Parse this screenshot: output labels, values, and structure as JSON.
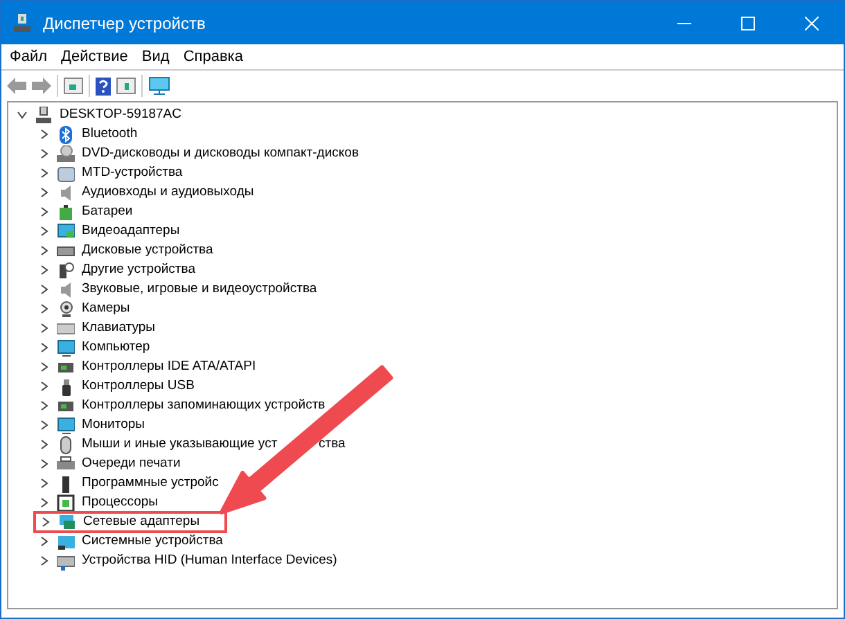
{
  "window": {
    "title": "Диспетчер устройств"
  },
  "menu": [
    "Файл",
    "Действие",
    "Вид",
    "Справка"
  ],
  "tree": {
    "label": "DESKTOP-59187AC",
    "expanded": true,
    "children": [
      {
        "label": "Bluetooth",
        "expanded": false,
        "highlighted": false
      },
      {
        "label": "DVD-дисководы и дисководы компакт-дисков",
        "expanded": false,
        "highlighted": false
      },
      {
        "label": "MTD-устройства",
        "expanded": false,
        "highlighted": false
      },
      {
        "label": "Аудиовходы и аудиовыходы",
        "expanded": false,
        "highlighted": false
      },
      {
        "label": "Батареи",
        "expanded": false,
        "highlighted": false
      },
      {
        "label": "Видеоадаптеры",
        "expanded": false,
        "highlighted": false
      },
      {
        "label": "Дисковые устройства",
        "expanded": false,
        "highlighted": false
      },
      {
        "label": "Другие устройства",
        "expanded": false,
        "highlighted": false
      },
      {
        "label": "Звуковые, игровые и видеоустройства",
        "expanded": false,
        "highlighted": false
      },
      {
        "label": "Камеры",
        "expanded": false,
        "highlighted": false
      },
      {
        "label": "Клавиатуры",
        "expanded": false,
        "highlighted": false
      },
      {
        "label": "Компьютер",
        "expanded": false,
        "highlighted": false
      },
      {
        "label": "Контроллеры IDE ATA/ATAPI",
        "expanded": false,
        "highlighted": false
      },
      {
        "label": "Контроллеры USB",
        "expanded": false,
        "highlighted": false
      },
      {
        "label": "Контроллеры запоминающих устройств",
        "expanded": false,
        "highlighted": false
      },
      {
        "label": "Мониторы",
        "expanded": false,
        "highlighted": false
      },
      {
        "label": "Мыши и иные указывающие уст",
        "label_after_arrow": "ства",
        "expanded": false,
        "highlighted": false
      },
      {
        "label": "Очереди печати",
        "expanded": false,
        "highlighted": false
      },
      {
        "label": "Программные устройс",
        "expanded": false,
        "highlighted": false
      },
      {
        "label": "Процессоры",
        "expanded": false,
        "highlighted": false
      },
      {
        "label": "Сетевые адаптеры",
        "expanded": false,
        "highlighted": true
      },
      {
        "label": "Системные устройства",
        "expanded": false,
        "highlighted": false
      },
      {
        "label": "Устройства HID (Human Interface Devices)",
        "expanded": false,
        "highlighted": false
      }
    ]
  }
}
